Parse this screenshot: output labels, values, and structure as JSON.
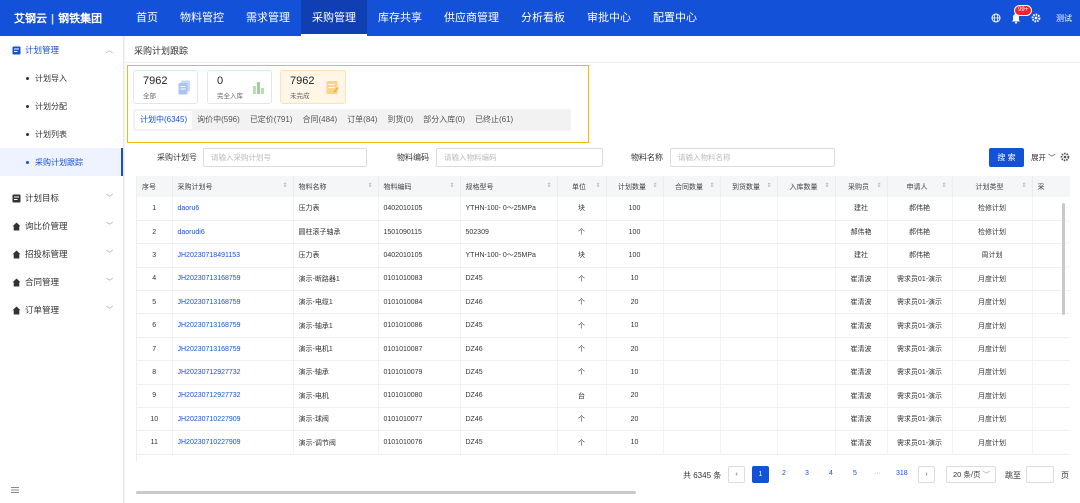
{
  "brand": {
    "name": "艾钢云",
    "separator": "|",
    "company": "钢铁集团"
  },
  "nav": {
    "items": [
      "首页",
      "物料管控",
      "需求管理",
      "采购管理",
      "库存共享",
      "供应商管理",
      "分析看板",
      "审批中心",
      "配置中心"
    ],
    "active_index": 3
  },
  "topbar": {
    "badge": "99+",
    "user": "测试",
    "accent": "#1451d9"
  },
  "sidebar": {
    "plan_mgmt": {
      "label": "计划管理",
      "items": [
        "计划导入",
        "计划分配",
        "计划列表",
        "采购计划跟踪"
      ]
    },
    "groups": [
      "计划目标",
      "询比价管理",
      "招投标管理",
      "合同管理",
      "订单管理"
    ]
  },
  "page": {
    "title": "采购计划跟踪"
  },
  "stats": [
    {
      "value": "7962",
      "label": "全部"
    },
    {
      "value": "0",
      "label": "完全入库"
    },
    {
      "value": "7962",
      "label": "未完成"
    }
  ],
  "tabs": [
    "计划中(6345)",
    "询价中(596)",
    "已定价(791)",
    "合同(484)",
    "订单(84)",
    "到货(0)",
    "部分入库(0)",
    "已终止(61)"
  ],
  "search": {
    "plan_no_label": "采购计划号",
    "plan_no_placeholder": "请输入采购计划号",
    "code_label": "物料编码",
    "code_placeholder": "请输入物料编码",
    "name_label": "物料名称",
    "name_placeholder": "请输入物料名称",
    "search_button": "搜 索",
    "expand": "展开"
  },
  "table": {
    "headers": [
      "序号",
      "采购计划号",
      "物料名称",
      "物料编码",
      "规格型号",
      "单位",
      "计划数量",
      "合同数量",
      "到货数量",
      "入库数量",
      "采购员",
      "申请人",
      "计划类型",
      "采"
    ],
    "rows": [
      [
        "1",
        "daoru6",
        "压力表",
        "0402010105",
        "YTHN-100- 0～25MPa",
        "块",
        "100",
        "",
        "",
        "",
        "建社",
        "郝伟艳",
        "检修计划"
      ],
      [
        "2",
        "daorudi6",
        "圆柱滚子轴承",
        "1501090115",
        "502309",
        "个",
        "100",
        "",
        "",
        "",
        "郝伟艳",
        "郝伟艳",
        "检修计划"
      ],
      [
        "3",
        "JH20230718491153",
        "压力表",
        "0402010105",
        "YTHN-100- 0～25MPa",
        "块",
        "100",
        "",
        "",
        "",
        "建社",
        "郝伟艳",
        "周计划"
      ],
      [
        "4",
        "JH20230713168759",
        "演示-断路器1",
        "0101010083",
        "DZ45",
        "个",
        "10",
        "",
        "",
        "",
        "崔清波",
        "需求员01-演示",
        "月度计划"
      ],
      [
        "5",
        "JH20230713168759",
        "演示-电缆1",
        "0101010084",
        "DZ46",
        "个",
        "20",
        "",
        "",
        "",
        "崔清波",
        "需求员01-演示",
        "月度计划"
      ],
      [
        "6",
        "JH20230713168759",
        "演示-轴承1",
        "0101010086",
        "DZ45",
        "个",
        "10",
        "",
        "",
        "",
        "崔清波",
        "需求员01-演示",
        "月度计划"
      ],
      [
        "7",
        "JH20230713168759",
        "演示-电机1",
        "0101010087",
        "DZ46",
        "个",
        "20",
        "",
        "",
        "",
        "崔清波",
        "需求员01-演示",
        "月度计划"
      ],
      [
        "8",
        "JH20230712927732",
        "演示-轴承",
        "0101010079",
        "DZ45",
        "个",
        "10",
        "",
        "",
        "",
        "崔清波",
        "需求员01-演示",
        "月度计划"
      ],
      [
        "9",
        "JH20230712927732",
        "演示-电机",
        "0101010080",
        "DZ46",
        "台",
        "20",
        "",
        "",
        "",
        "崔清波",
        "需求员01-演示",
        "月度计划"
      ],
      [
        "10",
        "JH20230710227909",
        "演示-球阀",
        "0101010077",
        "DZ46",
        "个",
        "20",
        "",
        "",
        "",
        "崔清波",
        "需求员01-演示",
        "月度计划"
      ],
      [
        "11",
        "JH20230710227909",
        "演示-调节阀",
        "0101010076",
        "DZ45",
        "个",
        "10",
        "",
        "",
        "",
        "崔清波",
        "需求员01-演示",
        "月度计划"
      ]
    ]
  },
  "pagination": {
    "total": "共 6345 条",
    "pages": [
      "1",
      "2",
      "3",
      "4",
      "5"
    ],
    "ellipsis": "···",
    "last": "318",
    "page_size": "20 条/页",
    "jump": "跳至",
    "page_unit": "页"
  }
}
